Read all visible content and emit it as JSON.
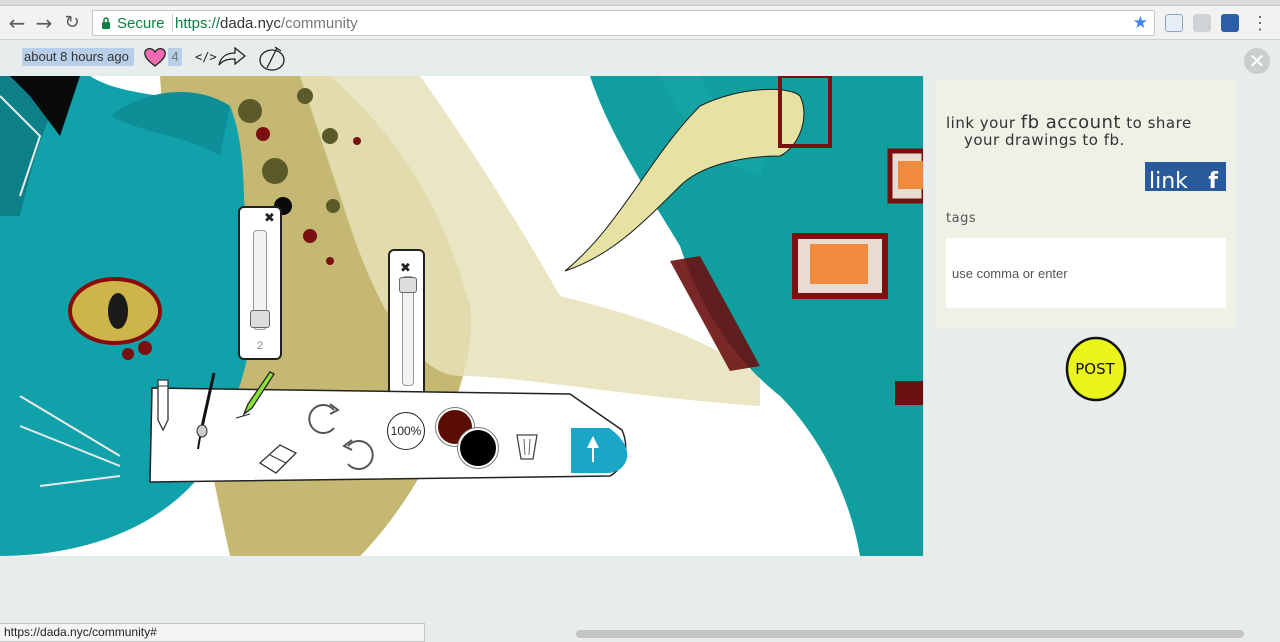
{
  "browser": {
    "secure_label": "Secure",
    "url_scheme": "https://",
    "url_host": "dada.nyc",
    "url_path": "/community",
    "status_url": "https://dada.nyc/community#",
    "icons": [
      "back-icon",
      "forward-icon",
      "reload-icon",
      "lock-icon",
      "star-icon",
      "extension-icon",
      "menu-icon"
    ]
  },
  "post_meta": {
    "time_ago": "about 8 hours ago",
    "like_count": "4",
    "embed_label": "</>"
  },
  "drawing_tools": {
    "brush_size_value": "2",
    "opacity_value": "100%",
    "primary_color": "#5b0d04",
    "secondary_color": "#000000",
    "accent_color": "#1aa6c7",
    "tools": [
      "pencil-icon",
      "brush-icon",
      "marker-icon",
      "eraser-icon",
      "redo-icon",
      "undo-icon",
      "trash-icon",
      "upload-icon"
    ]
  },
  "side_panel": {
    "fb_line1_a": "link your ",
    "fb_line1_b": "fb account",
    "fb_line1_c": " to share",
    "fb_line2": "your drawings to fb.",
    "link_label": "link",
    "fb_letter": "f",
    "tags_label": "tags",
    "tags_placeholder": "use comma or enter",
    "post_label": "POST"
  },
  "colors": {
    "brand_fb": "#2b5a9a",
    "post_yellow": "#e9f51a"
  }
}
